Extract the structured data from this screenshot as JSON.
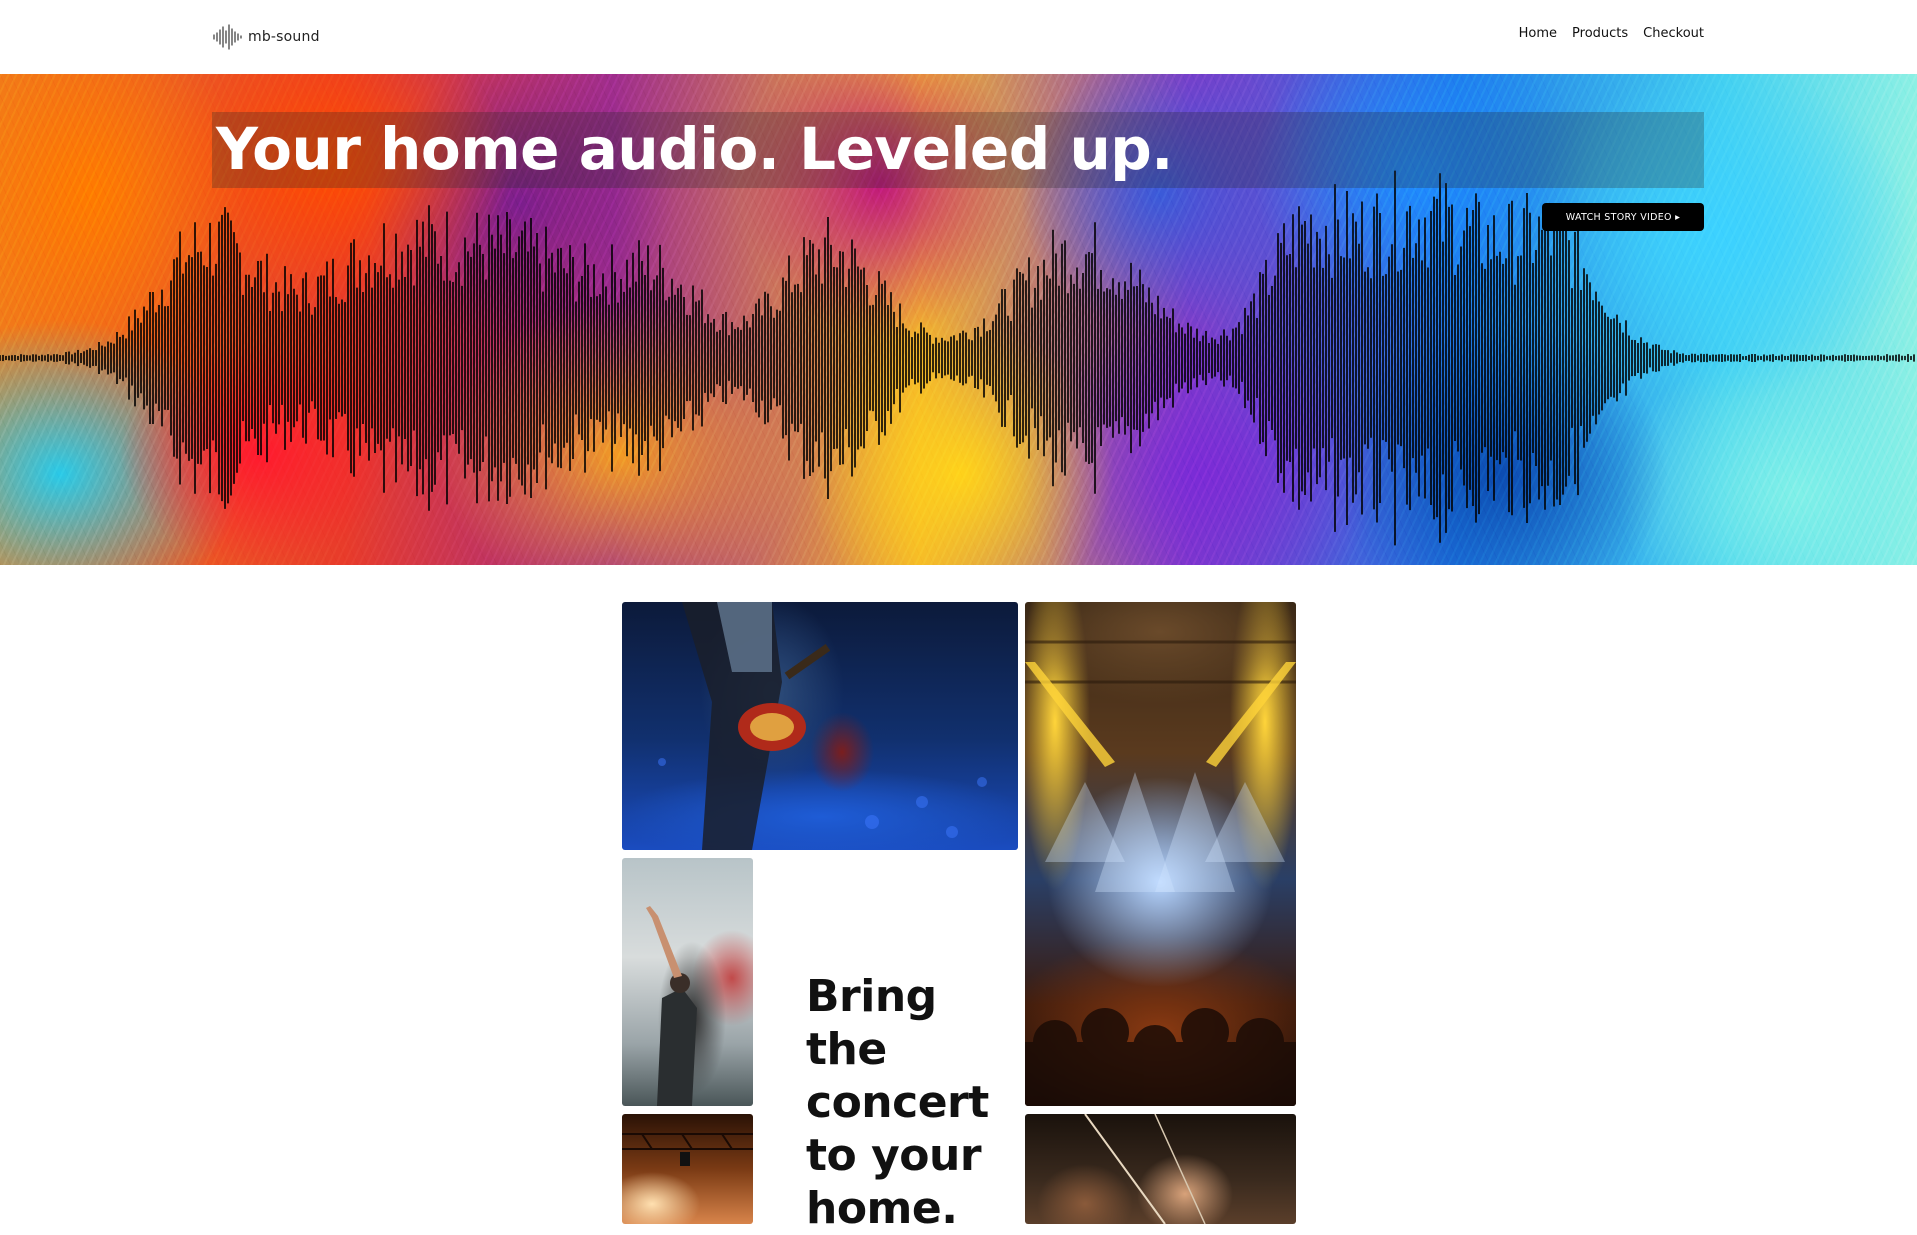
{
  "navbar": {
    "brand_name": "mb-sound",
    "brand_icon": "soundwave-icon",
    "links": [
      {
        "label": "Home"
      },
      {
        "label": "Products"
      },
      {
        "label": "Checkout"
      }
    ]
  },
  "hero": {
    "title": "Your home audio. Leveled up.",
    "watch_button_label": "WATCH STORY VIDEO ▸",
    "background_image": "colorful-paint-swirl-with-sound-waveform"
  },
  "gallery": {
    "tiles": [
      {
        "image": "guitarist-on-stage-blue-light"
      },
      {
        "image": "concert-stage-lights-crowd"
      },
      {
        "image": "singer-with-raised-hand-smoke"
      },
      {
        "image": "stage-lighting-rig"
      },
      {
        "image": "orchestra-violinist"
      }
    ],
    "tagline": "Bring the concert to your home."
  },
  "colors": {
    "background": "#ffffff",
    "button": "#000000",
    "title": "#ffffff",
    "text": "#111111"
  }
}
